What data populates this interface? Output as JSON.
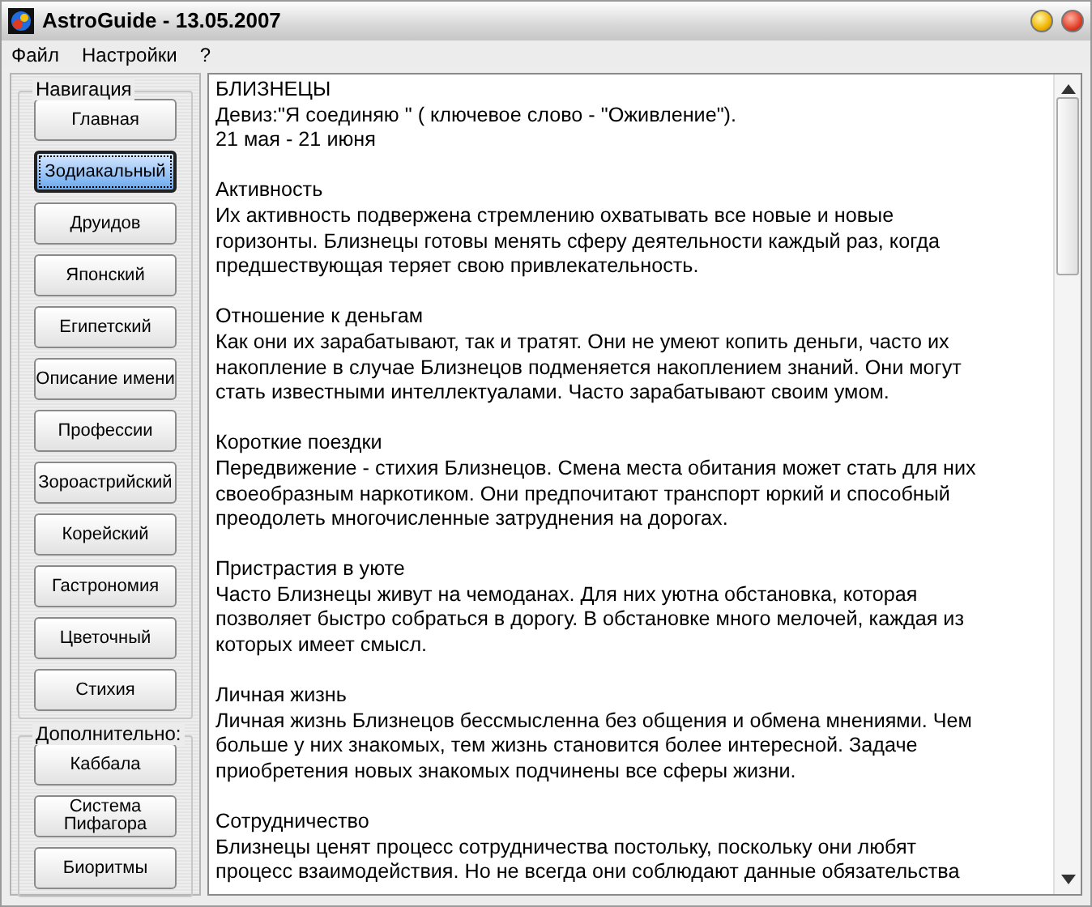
{
  "window": {
    "title": "AstroGuide - 13.05.2007"
  },
  "menu": [
    "Файл",
    "Настройки",
    "?"
  ],
  "sidebar": {
    "groups": [
      {
        "title": "Навигация",
        "items": [
          {
            "label": "Главная",
            "selected": false
          },
          {
            "label": "Зодиакальный",
            "selected": true
          },
          {
            "label": "Друидов",
            "selected": false
          },
          {
            "label": "Японский",
            "selected": false
          },
          {
            "label": "Египетский",
            "selected": false
          },
          {
            "label": "Описание имени",
            "selected": false
          },
          {
            "label": "Профессии",
            "selected": false
          },
          {
            "label": "Зороастрийский",
            "selected": false
          },
          {
            "label": "Корейский",
            "selected": false
          },
          {
            "label": "Гастрономия",
            "selected": false
          },
          {
            "label": "Цветочный",
            "selected": false
          },
          {
            "label": "Стихия",
            "selected": false
          }
        ]
      },
      {
        "title": "Дополнительно:",
        "items": [
          {
            "label": "Каббала",
            "selected": false
          },
          {
            "label": "Система\nПифагора",
            "selected": false
          },
          {
            "label": "Биоритмы",
            "selected": false
          }
        ]
      }
    ]
  },
  "content": {
    "title": "БЛИЗНЕЦЫ",
    "motto": "Девиз:\"Я соединяю \" ( ключевое слово - \"Оживление\").",
    "dates": "21 мая - 21 июня",
    "sections": [
      {
        "heading": "Активность",
        "text": "Их активность подвержена стремлению охватывать все новые и новые\nгоризонты. Близнецы готовы менять сферу деятельности каждый раз, когда\nпредшествующая теряет свою привлекательность."
      },
      {
        "heading": "Отношение к деньгам",
        "text": "Как они их зарабатывают, так и тратят. Они не умеют копить деньги, часто их\nнакопление в случае Близнецов подменяется накоплением знаний. Они могут\nстать известными интеллектуалами. Часто зарабатывают своим умом."
      },
      {
        "heading": "Короткие поездки",
        "text": "Передвижение - стихия Близнецов. Смена места обитания может стать для них\nсвоеобразным наркотиком. Они предпочитают транспорт юркий и способный\nпреодолеть многочисленные затруднения на дорогах."
      },
      {
        "heading": "Пристрастия в уюте",
        "text": "Часто Близнецы живут на чемоданах. Для них уютна обстановка, которая\nпозволяет быстро собраться в дорогу. В обстановке много мелочей, каждая из\nкоторых имеет смысл."
      },
      {
        "heading": "Личная жизнь",
        "text": "Личная жизнь Близнецов бессмысленна без общения и обмена мнениями. Чем\nбольше у них знакомых, тем жизнь становится более интересной. Задаче\nприобретения новых знакомых подчинены все сферы жизни."
      },
      {
        "heading": "Сотрудничество",
        "text": "Близнецы ценят процесс сотрудничества постольку, поскольку они любят\nпроцесс взаимодействия. Но не всегда они соблюдают данные обязательства"
      }
    ]
  }
}
